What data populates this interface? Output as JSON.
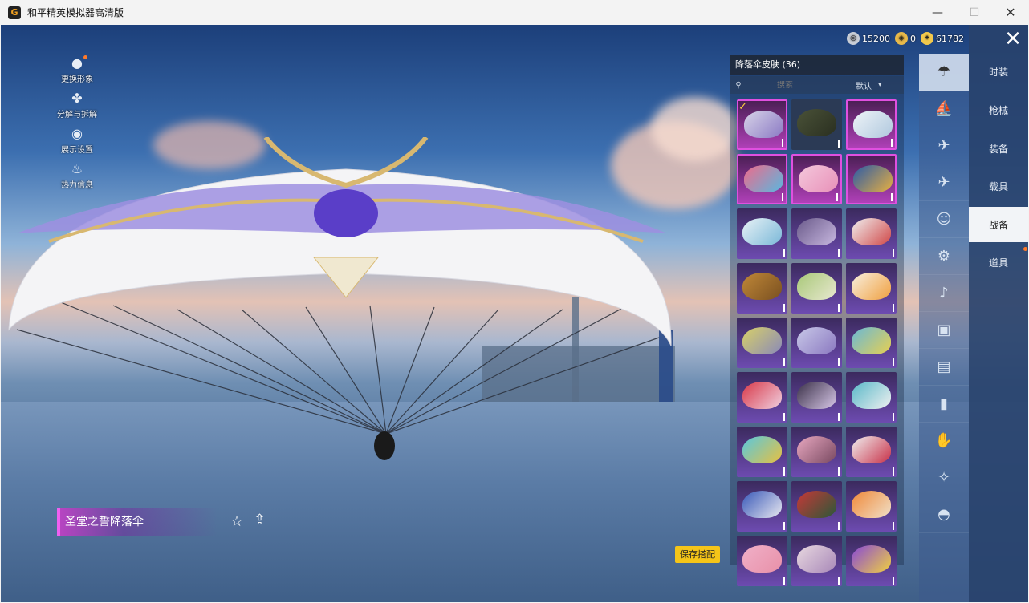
{
  "window": {
    "title": "和平精英模拟器高清版",
    "app_icon_glyph": "G",
    "minimize": "—",
    "maximize": "☐",
    "close": "✕"
  },
  "left_menu": [
    {
      "label": "更换形象",
      "icon": "avatar-icon"
    },
    {
      "label": "分解与拆解",
      "icon": "puzzle-icon"
    },
    {
      "label": "展示设置",
      "icon": "eye-icon"
    },
    {
      "label": "热力信息",
      "icon": "flame-icon"
    }
  ],
  "currencies": [
    {
      "value": "15200",
      "icon": "silver-coin-icon",
      "color": "#c9ced6"
    },
    {
      "value": "0",
      "icon": "gold-medal-icon",
      "color": "#e8b94a"
    },
    {
      "value": "61782",
      "icon": "gold-coin-icon",
      "color": "#f2c84b"
    }
  ],
  "close_glyph": "✕",
  "right_tabs": [
    {
      "label": "时装",
      "active": false
    },
    {
      "label": "枪械",
      "active": false
    },
    {
      "label": "装备",
      "active": false
    },
    {
      "label": "载具",
      "active": false
    },
    {
      "label": "战备",
      "active": true
    },
    {
      "label": "道具",
      "active": false
    }
  ],
  "category_icons": [
    "parachute-icon",
    "boat-icon",
    "drone-icon",
    "plane-icon",
    "emote-icon",
    "robot-icon",
    "speaker-icon",
    "sticker-icon",
    "photo-icon",
    "extinguisher-icon",
    "hand-icon",
    "wand-icon",
    "ufo-icon"
  ],
  "panel": {
    "title": "降落伞皮肤 (36)",
    "search_placeholder": "搜索",
    "sort_value": "默认"
  },
  "skins": [
    {
      "quality": "pink",
      "colors": [
        "#d8d4e8",
        "#8a79c4"
      ],
      "selected": true
    },
    {
      "quality": "dark",
      "colors": [
        "#4a5238",
        "#2a2f20"
      ],
      "selected": false
    },
    {
      "quality": "pink",
      "colors": [
        "#eef4f8",
        "#b0c8de"
      ],
      "selected": false
    },
    {
      "quality": "pink",
      "colors": [
        "#f06a8a",
        "#58b8e0"
      ],
      "selected": false
    },
    {
      "quality": "pink",
      "colors": [
        "#f4c8dc",
        "#e890b8"
      ],
      "selected": false
    },
    {
      "quality": "pink",
      "colors": [
        "#2a5aa8",
        "#e8b040"
      ],
      "selected": false
    },
    {
      "quality": "purple",
      "colors": [
        "#e8f2f6",
        "#7ab8d8"
      ],
      "selected": false
    },
    {
      "quality": "purple",
      "colors": [
        "#6a5a8a",
        "#c8b8e0"
      ],
      "selected": false
    },
    {
      "quality": "purple",
      "colors": [
        "#f0f0f0",
        "#d04848"
      ],
      "selected": false
    },
    {
      "quality": "purple",
      "colors": [
        "#c08838",
        "#7a5020"
      ],
      "selected": false
    },
    {
      "quality": "purple",
      "colors": [
        "#a8c878",
        "#e8e8d0"
      ],
      "selected": false
    },
    {
      "quality": "purple",
      "colors": [
        "#f8f0e0",
        "#f0a040"
      ],
      "selected": false
    },
    {
      "quality": "purple",
      "colors": [
        "#d8d068",
        "#8a8ab8"
      ],
      "selected": false
    },
    {
      "quality": "purple",
      "colors": [
        "#c8c8e8",
        "#8a78c0"
      ],
      "selected": false
    },
    {
      "quality": "purple",
      "colors": [
        "#68b8d8",
        "#e8d050"
      ],
      "selected": false
    },
    {
      "quality": "purple",
      "colors": [
        "#d83848",
        "#f0d0e0"
      ],
      "selected": false
    },
    {
      "quality": "purple",
      "colors": [
        "#3a3048",
        "#d8c8e8"
      ],
      "selected": false
    },
    {
      "quality": "purple",
      "colors": [
        "#58b8c8",
        "#f0f0f0"
      ],
      "selected": false
    },
    {
      "quality": "purple",
      "colors": [
        "#58c8e0",
        "#e8c040"
      ],
      "selected": false
    },
    {
      "quality": "purple",
      "colors": [
        "#e8a8c0",
        "#784860"
      ],
      "selected": false
    },
    {
      "quality": "purple",
      "colors": [
        "#f0f0f0",
        "#c83048"
      ],
      "selected": false
    },
    {
      "quality": "purple",
      "colors": [
        "#3858b8",
        "#e8e8f0"
      ],
      "selected": false
    },
    {
      "quality": "purple",
      "colors": [
        "#c83838",
        "#2a5838"
      ],
      "selected": false
    },
    {
      "quality": "purple",
      "colors": [
        "#f08838",
        "#f0e0c8"
      ],
      "selected": false
    },
    {
      "quality": "purple",
      "colors": [
        "#f0b0c8",
        "#e890a8"
      ],
      "selected": false
    },
    {
      "quality": "purple",
      "colors": [
        "#e8d8e0",
        "#a888b8"
      ],
      "selected": false
    },
    {
      "quality": "purple",
      "colors": [
        "#8848d8",
        "#f0d040"
      ],
      "selected": false
    }
  ],
  "skin_name": "圣堂之誓降落伞",
  "star_glyph": "☆",
  "share_glyph": "⇪",
  "save_button": "保存搭配"
}
